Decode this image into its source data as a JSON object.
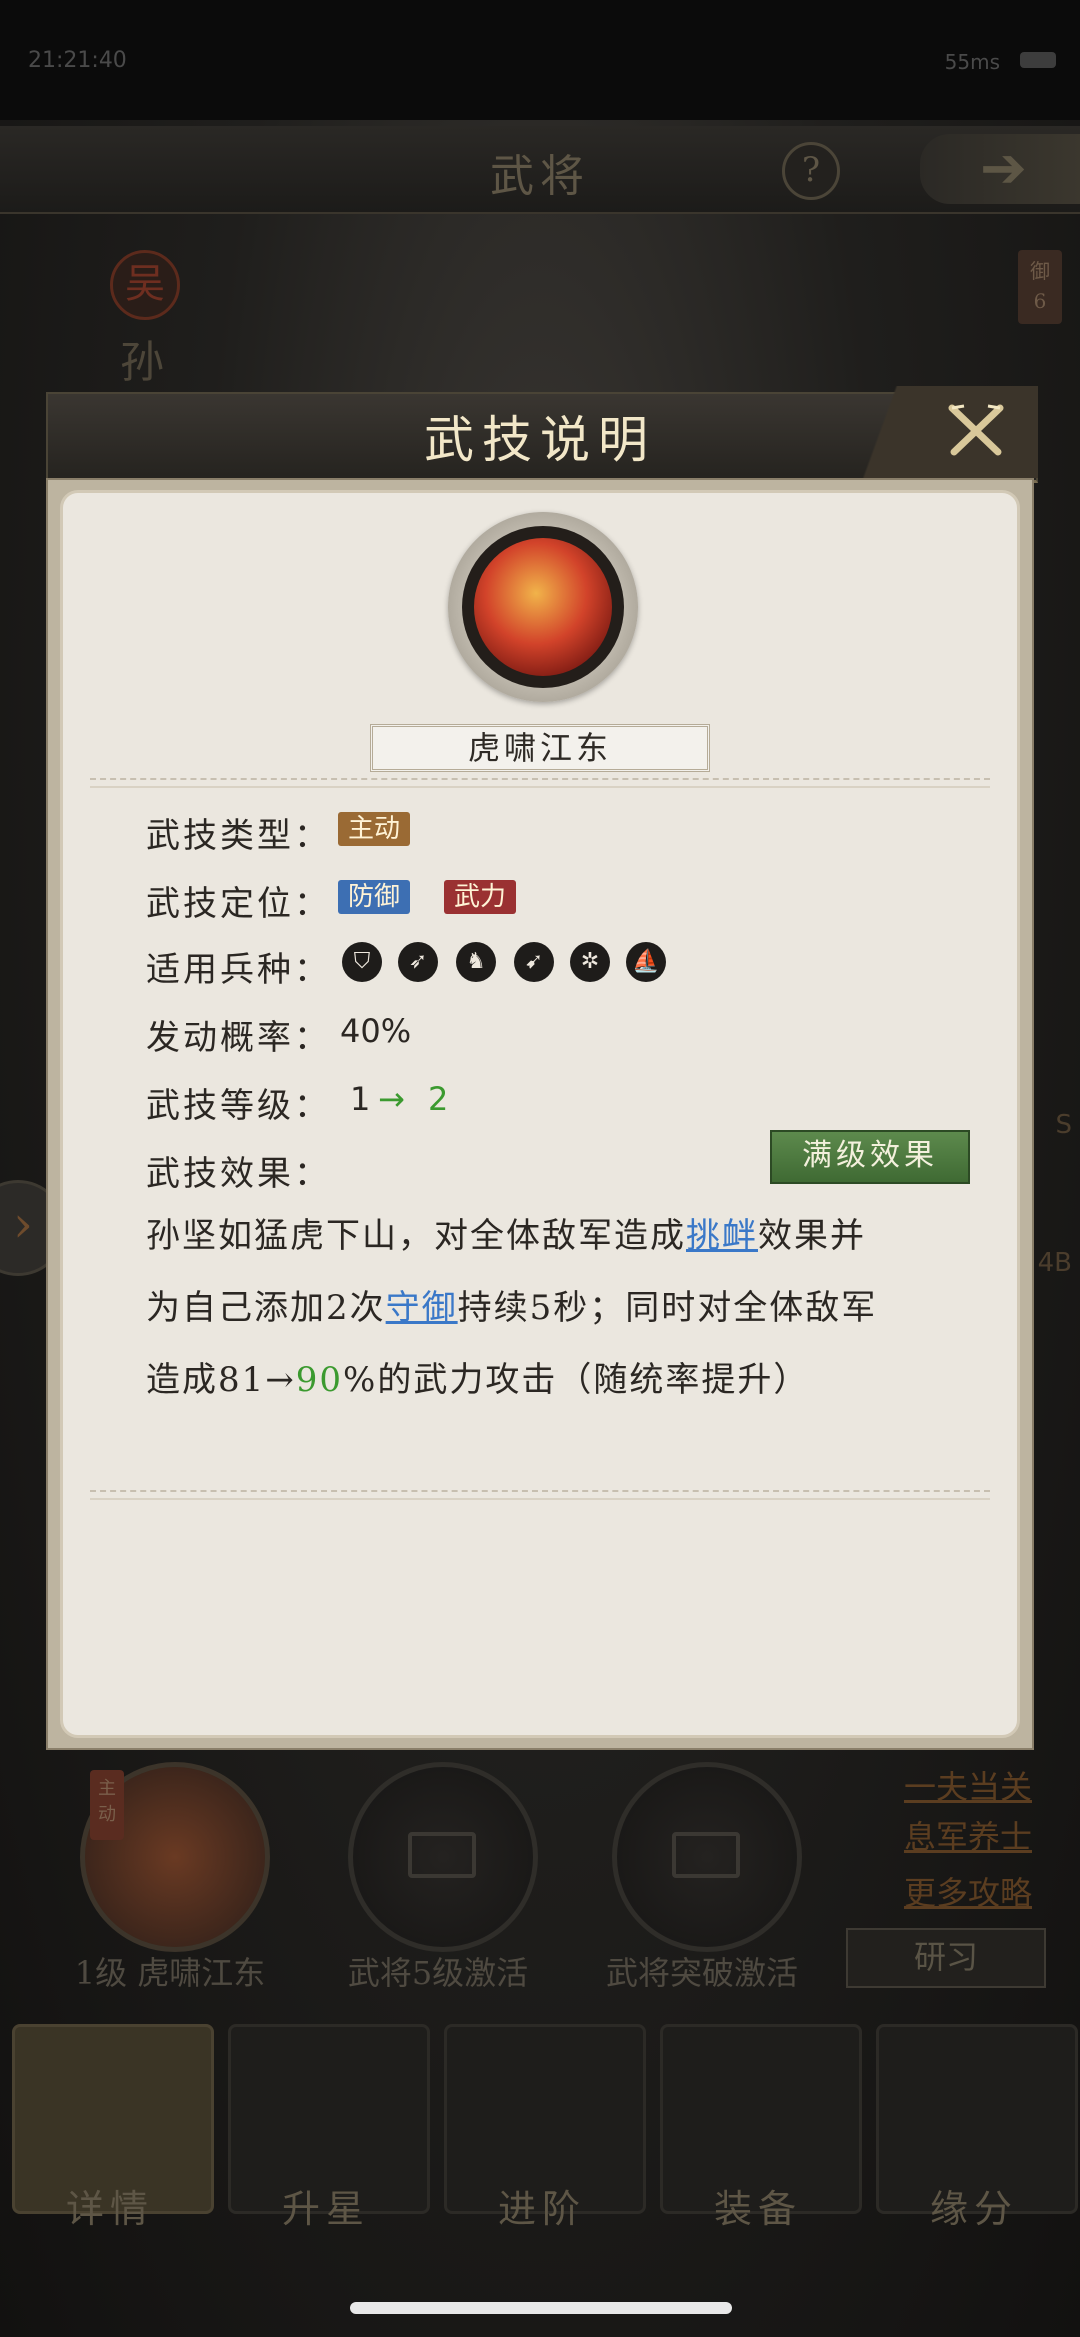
{
  "status_bar": {
    "time": "21:21:40",
    "network": "55ms"
  },
  "top_bar": {
    "title": "武将",
    "help": "?"
  },
  "hero": {
    "faction": "吴",
    "name": "孙",
    "defense_tag": "御",
    "defense_value": "6"
  },
  "right_edge_labels": [
    "S",
    "4B"
  ],
  "skill_slots": [
    {
      "label": "1级 虎啸江东",
      "tag": "主动"
    },
    {
      "label": "武将5级激活"
    },
    {
      "label": "武将突破激活"
    }
  ],
  "guides": [
    "一夫当关",
    "息军养士",
    "更多攻略"
  ],
  "study_button": "研习",
  "bottom_nav": [
    "详情",
    "升星",
    "进阶",
    "装备",
    "缘分"
  ],
  "modal": {
    "title": "武技说明",
    "skill_name": "虎啸江东",
    "type_label": "武技类型：",
    "type_value": "主动",
    "position_label": "武技定位：",
    "position_tags": [
      "防御",
      "武力"
    ],
    "troops_label": "适用兵种：",
    "troop_icons": [
      "shield-troop-icon",
      "spear-troop-icon",
      "cavalry-troop-icon",
      "archer-troop-icon",
      "chariot-troop-icon",
      "navy-troop-icon"
    ],
    "chance_label": "发动概率：",
    "chance_value": "40%",
    "level_label": "武技等级：",
    "level_from": "1",
    "level_arrow": "→",
    "level_to": "2",
    "effect_label": "武技效果：",
    "max_level_button": "满级效果",
    "effect": {
      "p1": "孙坚如猛虎下山，对全体敌军造成",
      "link1": "挑衅",
      "p2": "效果并",
      "p3": "为自己添加2次",
      "link2": "守御",
      "p4": "持续5秒；同时对全体敌军",
      "p5": "造成81→",
      "green": "90",
      "p6": "%的武力攻击（随统率提升）"
    }
  }
}
